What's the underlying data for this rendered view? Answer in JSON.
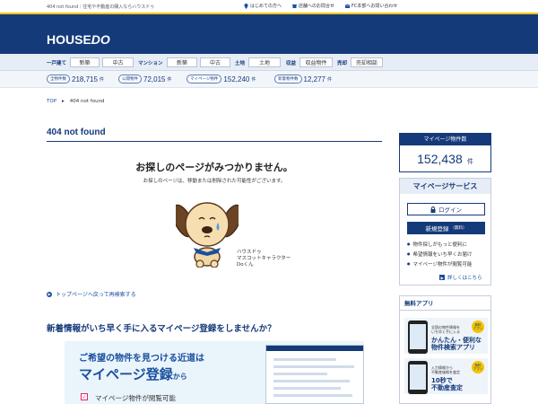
{
  "topbar": {
    "tagline": "404 not found｜住宅や不動産の購入ならハウスドゥ",
    "links": [
      "はじめての方へ",
      "店舗へのお問合せ",
      "FC本部へお問い合わせ"
    ]
  },
  "header": {
    "logo_main": "HOUSE",
    "logo_accent": "DO"
  },
  "nav": {
    "groups": [
      {
        "category": "一戸建て",
        "buttons": [
          "新築",
          "中古"
        ]
      },
      {
        "category": "マンション",
        "buttons": [
          "新築",
          "中古"
        ]
      },
      {
        "category": "土地",
        "buttons": [
          "土地"
        ]
      },
      {
        "category": "収益",
        "buttons": [
          "収益物件"
        ]
      },
      {
        "category": "売却",
        "buttons": [
          "売却相談"
        ]
      }
    ]
  },
  "stats": [
    {
      "label": "全物件数",
      "value": "218,715",
      "unit": "件"
    },
    {
      "label": "公開物件",
      "value": "72,015",
      "unit": "件"
    },
    {
      "label": "マイページ物件",
      "value": "152,240",
      "unit": "件"
    },
    {
      "label": "新着物件数",
      "value": "12,277",
      "unit": "件"
    }
  ],
  "breadcrumb": {
    "home": "TOP",
    "separator": "▸",
    "current": "404 not found"
  },
  "main": {
    "title": "404 not found",
    "message_head": "お探しのページがみつかりません。",
    "message_sub": "お探しのページは、移動または削除された可能性がございます。",
    "mascot_caption": [
      "ハウスドゥ",
      "マスコットキャラクター",
      "Doくん"
    ],
    "back_link": "トップページへ戻って再検索する",
    "promo_heading": "新着情報がいち早く手に入るマイページ登録をしませんか？",
    "promo_line1": "ご希望の物件を見つける近道は",
    "promo_line2": "マイページ登録",
    "promo_line2_suffix": "から",
    "promo_line3": "マイページ物件が閲覧可能"
  },
  "sidebar": {
    "count_title": "マイページ物件数",
    "count_value": "152,438",
    "count_unit": "件",
    "service_title": "マイページサービス",
    "login_label": "ログイン",
    "register_label": "新規登録",
    "register_note": "（無料）",
    "benefits": [
      "物件探しがもっと便利に",
      "希望情報をいち早くお届け",
      "マイページ物件が閲覧可能"
    ],
    "more_label": "詳しくはこちら",
    "app_title": "無料アプリ",
    "apps": [
      {
        "sub": "全国の物件情報を\nいち早く手に入る",
        "name": "かんたん・便利な\n物件検索アプリ",
        "badge": "無料\nアプリ"
      },
      {
        "sub": "入力情報から\n不動産価格を査定",
        "name": "10秒で\n不動産査定",
        "badge": "無料\nアプリ"
      }
    ]
  },
  "colors": {
    "brand": "#153a7a",
    "accent": "#f5c400",
    "link": "#1a4fa0"
  }
}
